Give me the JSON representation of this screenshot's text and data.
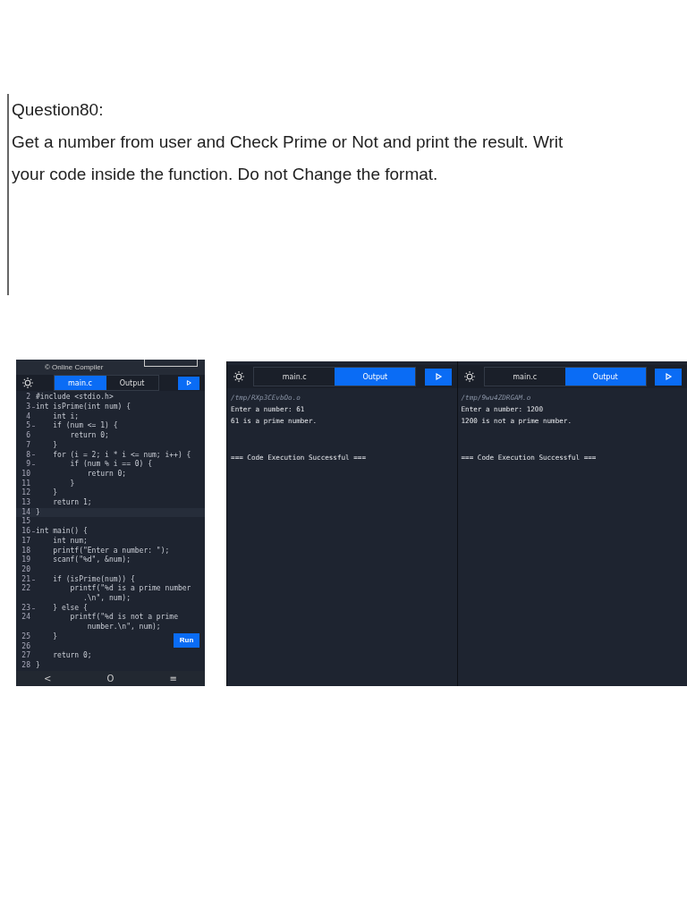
{
  "question": {
    "title": "Question80:",
    "lines": [
      "Get a number from user and Check Prime or Not and print the result. Writ",
      "your code inside the function. Do not Change the format."
    ]
  },
  "editor": {
    "header": "© Online Compiler",
    "tabs": [
      {
        "label": "main.c",
        "selected": true
      },
      {
        "label": "Output",
        "selected": false
      }
    ],
    "code": [
      {
        "num": "2",
        "text": "#include <stdio.h>",
        "fold": false,
        "current": false
      },
      {
        "num": "3",
        "text": "int isPrime(int num) {",
        "fold": true,
        "current": false
      },
      {
        "num": "4",
        "text": "    int i;",
        "fold": false,
        "current": false
      },
      {
        "num": "5",
        "text": "    if (num <= 1) {",
        "fold": true,
        "current": false
      },
      {
        "num": "6",
        "text": "        return 0;",
        "fold": false,
        "current": false
      },
      {
        "num": "7",
        "text": "    }",
        "fold": false,
        "current": false
      },
      {
        "num": "8",
        "text": "    for (i = 2; i * i <= num; i++) {",
        "fold": true,
        "current": false
      },
      {
        "num": "9",
        "text": "        if (num % i == 0) {",
        "fold": true,
        "current": false
      },
      {
        "num": "10",
        "text": "            return 0;",
        "fold": false,
        "current": false
      },
      {
        "num": "11",
        "text": "        }",
        "fold": false,
        "current": false
      },
      {
        "num": "12",
        "text": "    }",
        "fold": false,
        "current": false
      },
      {
        "num": "13",
        "text": "    return 1;",
        "fold": false,
        "current": false
      },
      {
        "num": "14",
        "text": "}",
        "fold": false,
        "current": true
      },
      {
        "num": "15",
        "fold": false,
        "current": false
      },
      {
        "num": "16",
        "text": "int main() {",
        "fold": true,
        "current": false
      },
      {
        "num": "17",
        "text": "    int num;",
        "fold": false,
        "current": false
      },
      {
        "num": "18",
        "text": "    printf(\"Enter a number: \");",
        "fold": false,
        "current": false
      },
      {
        "num": "19",
        "text": "    scanf(\"%d\", &num);",
        "fold": false,
        "current": false
      },
      {
        "num": "20",
        "fold": false,
        "current": false
      },
      {
        "num": "21",
        "text": "    if (isPrime(num)) {",
        "fold": true,
        "current": false
      },
      {
        "num": "22",
        "text": "        printf(\"%d is a prime number\n           .\\n\", num);",
        "fold": false,
        "current": false
      },
      {
        "num": "23",
        "text": "    } else {",
        "fold": true,
        "current": false
      },
      {
        "num": "24",
        "text": "        printf(\"%d is not a prime\n            number.\\n\", num);",
        "fold": false,
        "current": false
      },
      {
        "num": "25",
        "text": "    }",
        "fold": false,
        "current": false
      },
      {
        "num": "26",
        "fold": false,
        "current": false
      },
      {
        "num": "27",
        "text": "    return 0;",
        "fold": false,
        "current": false
      },
      {
        "num": "28",
        "text": "}",
        "fold": false,
        "current": false
      }
    ],
    "run_button": "Run",
    "nav": [
      "<",
      "O",
      "≡"
    ]
  },
  "outputs": [
    {
      "tabs": [
        {
          "label": "main.c",
          "selected": false
        },
        {
          "label": "Output",
          "selected": true
        }
      ],
      "path": "/tmp/RXp3CEvbOo.o",
      "lines": [
        "Enter a number: 61",
        "61 is a prime number."
      ],
      "status": "=== Code Execution Successful ==="
    },
    {
      "tabs": [
        {
          "label": "main.c",
          "selected": false
        },
        {
          "label": "Output",
          "selected": true
        }
      ],
      "path": "/tmp/9wu4ZDRGAM.o",
      "lines": [
        "Enter a number: 1200",
        "1200 is not a prime number."
      ],
      "status": "=== Code Execution Successful ==="
    }
  ]
}
